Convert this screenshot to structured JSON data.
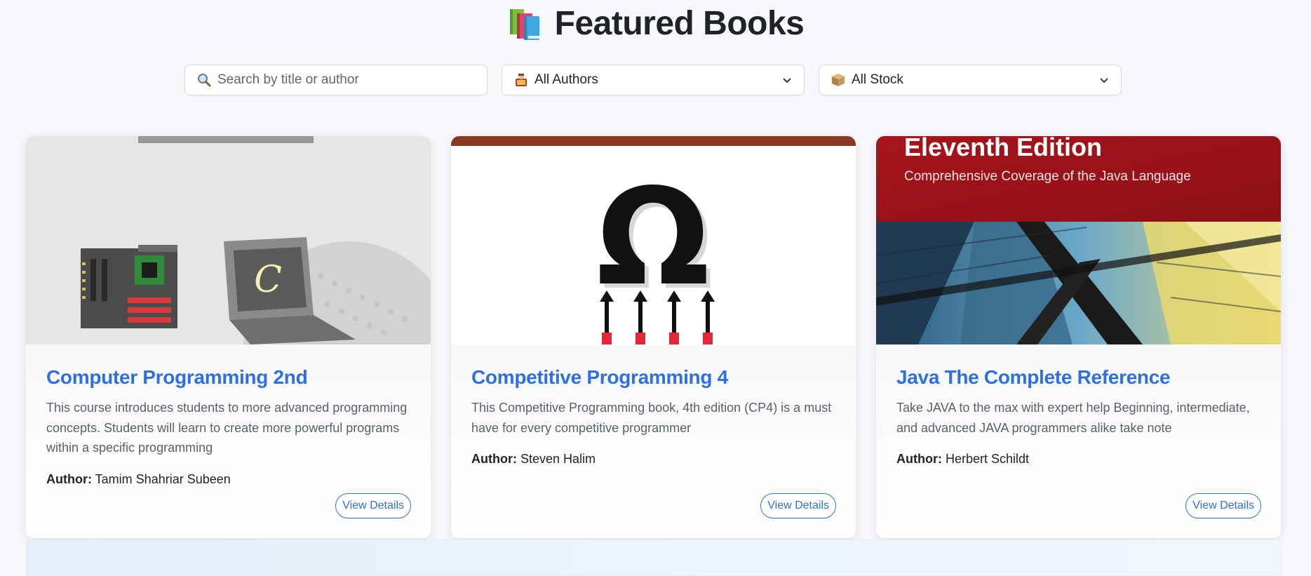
{
  "header": {
    "title": "Featured Books",
    "icon": "books-icon"
  },
  "filters": {
    "search_placeholder": "Search by title or author",
    "search_value": "",
    "authors_selected": "All Authors",
    "stock_selected": "All Stock"
  },
  "colors": {
    "accent": "#2f6fe0",
    "page_bg": "#f6f8fb"
  },
  "cards": [
    {
      "title": "Computer Programming 2nd",
      "description": "This course introduces students to more advanced programming concepts. Students will learn to create more powerful programs within a specific programming",
      "author_label": "Author:",
      "author": "Tamim Shahriar Subeen",
      "button": "View Details",
      "cover_glyph": "C"
    },
    {
      "title": "Competitive Programming 4",
      "description": "This Competitive Programming book, 4th edition (CP4) is a must have for every competitive programmer",
      "author_label": "Author:",
      "author": "Steven Halim",
      "button": "View Details",
      "cover_glyph": "Ω"
    },
    {
      "title": "Java The Complete Reference",
      "description": "Take JAVA to the max with expert help Beginning, intermediate, and advanced JAVA programmers alike take note",
      "author_label": "Author:",
      "author": "Herbert Schildt",
      "button": "View Details",
      "cover_line1": "Eleventh Edition",
      "cover_line2": "Comprehensive Coverage of the Java Language"
    }
  ]
}
